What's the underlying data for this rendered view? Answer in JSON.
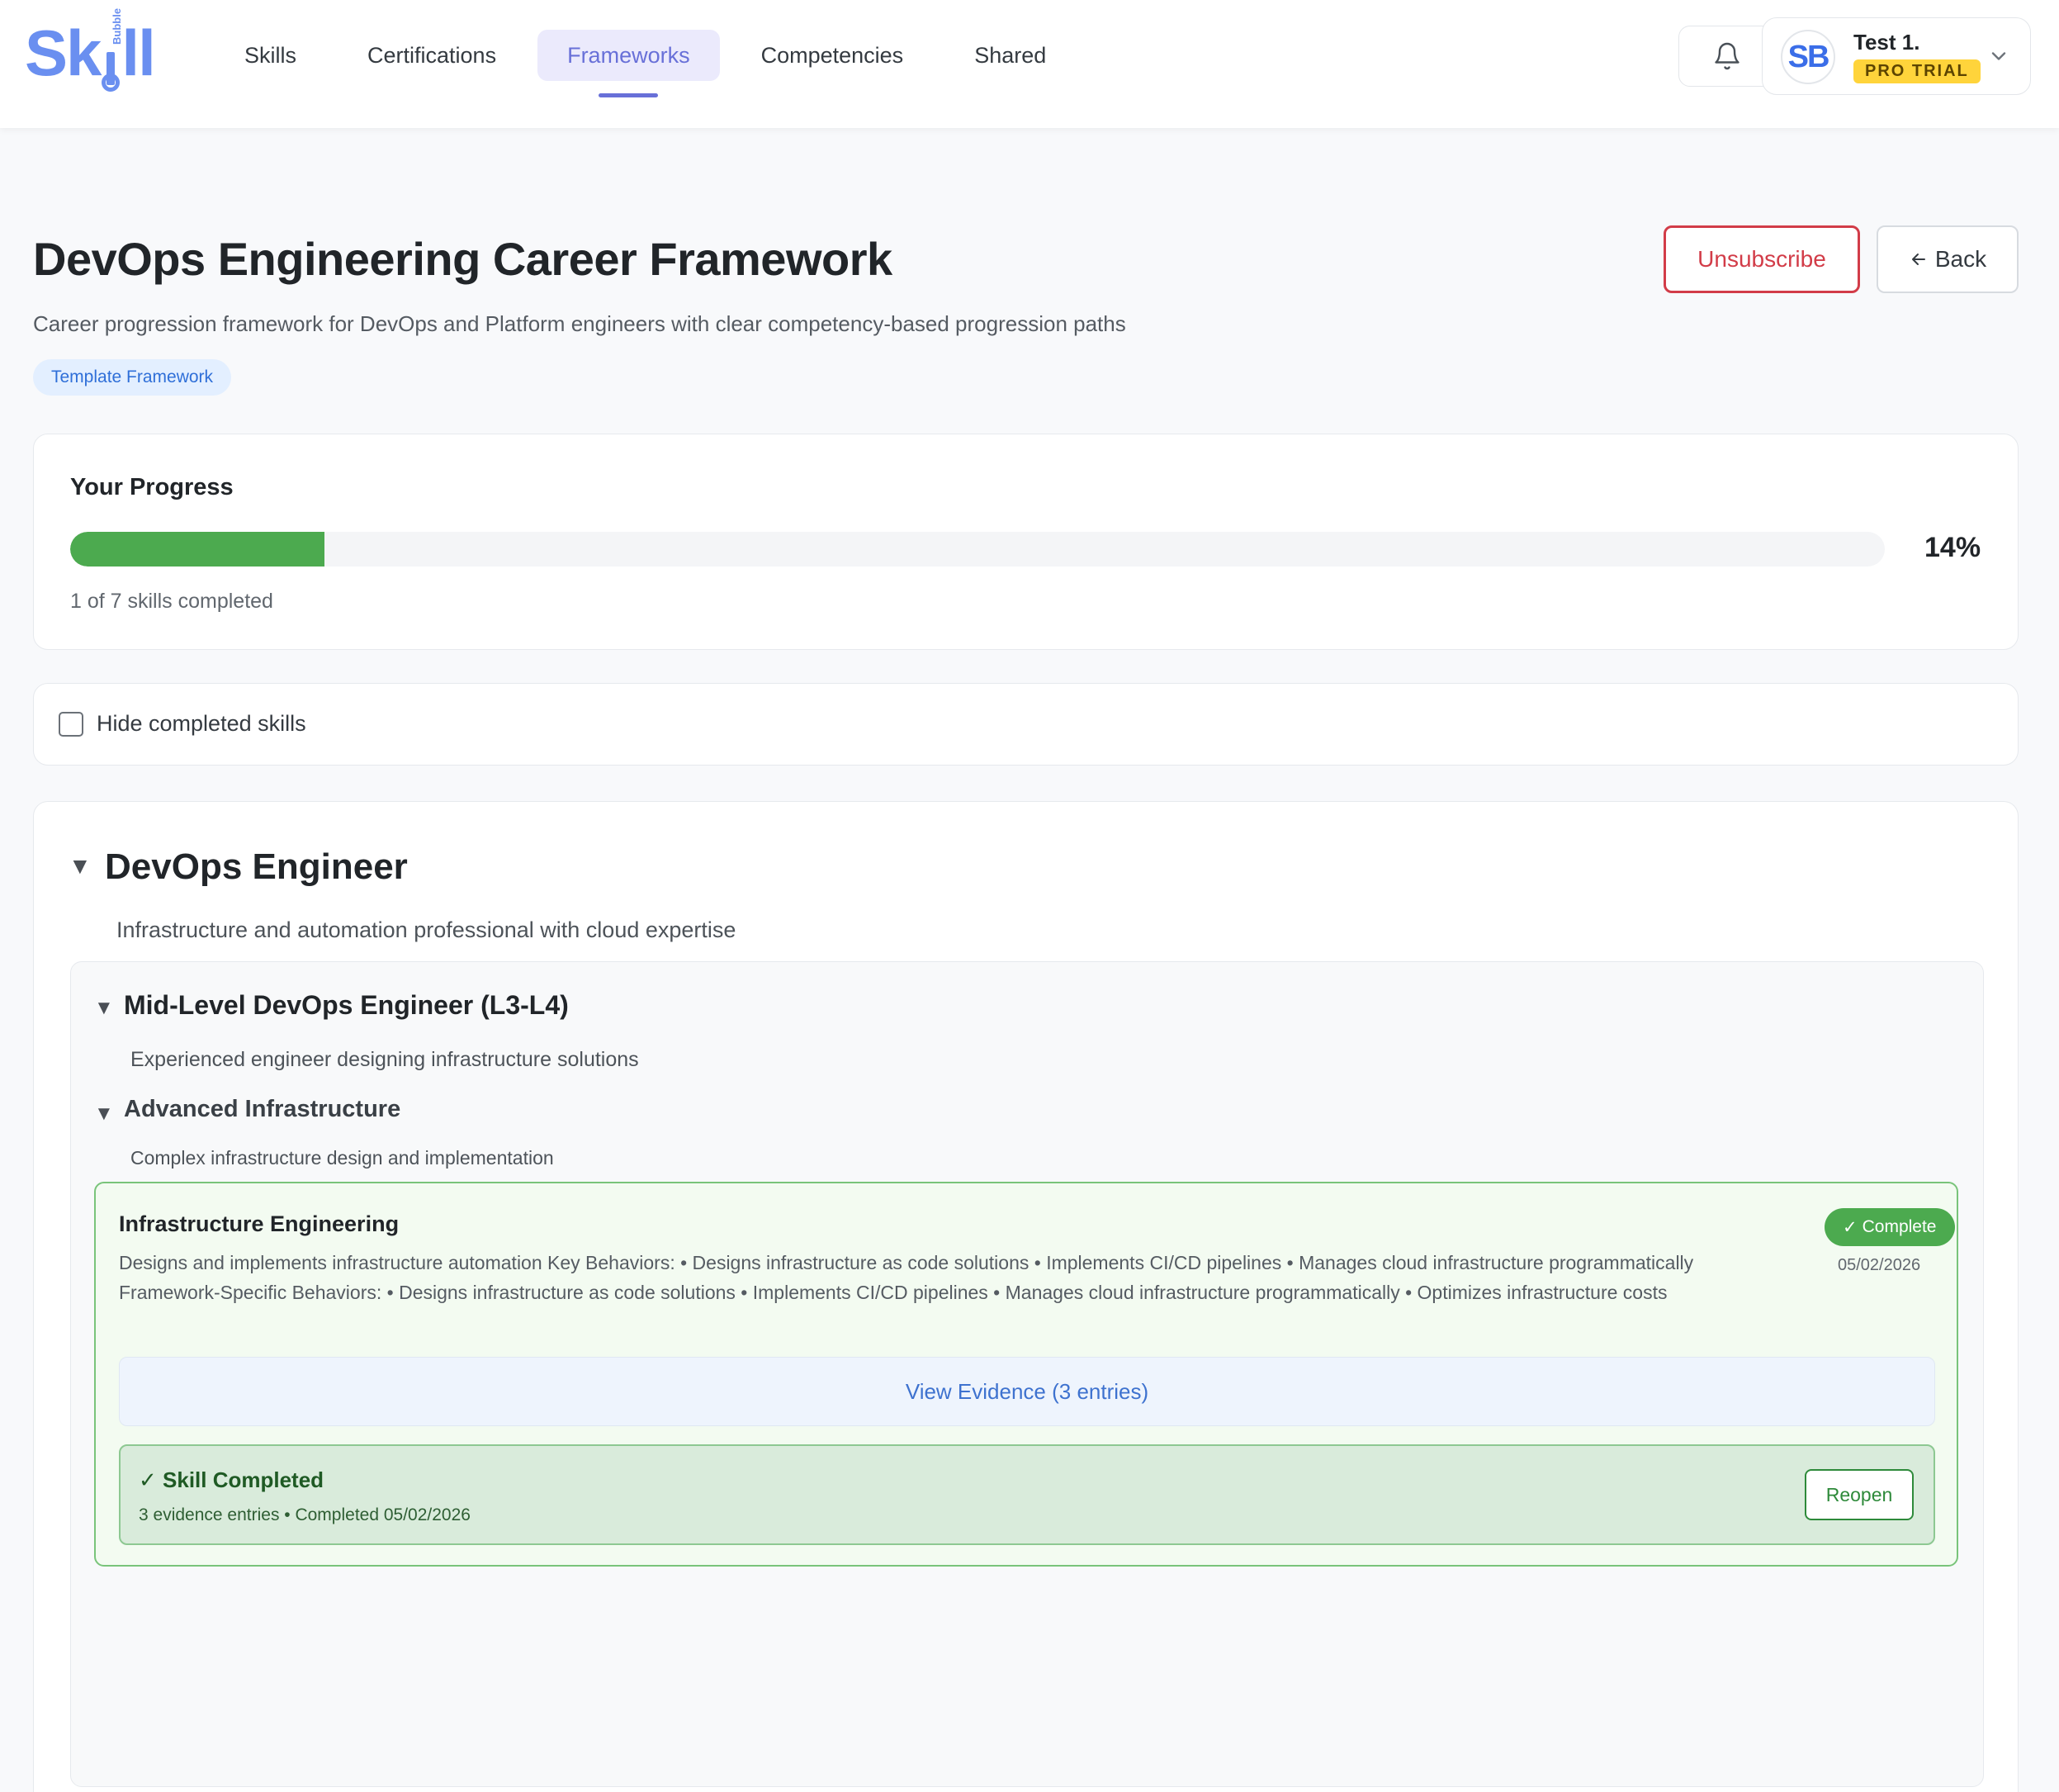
{
  "brand": {
    "name_prefix": "Sk",
    "name_suffix": "ll",
    "sub": "Bubble",
    "accent": "#6a8ff0"
  },
  "nav": {
    "items": [
      {
        "label": "Skills",
        "active": false
      },
      {
        "label": "Certifications",
        "active": false
      },
      {
        "label": "Frameworks",
        "active": true
      },
      {
        "label": "Competencies",
        "active": false
      },
      {
        "label": "Shared",
        "active": false
      }
    ]
  },
  "header": {
    "bell_icon": "bell-icon",
    "user": {
      "initials": "SB",
      "name": "Test 1.",
      "plan_badge": "PRO TRIAL"
    }
  },
  "page": {
    "title": "DevOps Engineering Career Framework",
    "description": "Career progression framework for DevOps and Platform engineers with clear competency-based progression paths",
    "badge": "Template Framework",
    "unsubscribe_label": "Unsubscribe",
    "back_label": "Back"
  },
  "progress": {
    "title": "Your Progress",
    "percent_value": 14,
    "percent_label": "14%",
    "summary": "1 of 7 skills completed",
    "fill_color": "#4caa4f"
  },
  "filter": {
    "hide_completed_label": "Hide completed skills",
    "checked": false
  },
  "framework": {
    "role": {
      "title": "DevOps Engineer",
      "description": "Infrastructure and automation professional with cloud expertise",
      "level": {
        "title": "Mid-Level DevOps Engineer (L3-L4)",
        "description": "Experienced engineer designing infrastructure solutions",
        "competency": {
          "title": "Advanced Infrastructure",
          "description": "Complex infrastructure design and implementation",
          "skill": {
            "title": "Infrastructure Engineering",
            "description": "Designs and implements infrastructure automation Key Behaviors: • Designs infrastructure as code solutions • Implements CI/CD pipelines • Manages cloud infrastructure programmatically Framework-Specific Behaviors: • Designs infrastructure as code solutions • Implements CI/CD pipelines • Manages cloud infrastructure programmatically • Optimizes infrastructure costs",
            "status_badge": "Complete",
            "date": "05/02/2026",
            "evidence_label": "View Evidence (3 entries)",
            "completed_title": "Skill Completed",
            "completed_sub": "3 evidence entries • Completed 05/02/2026",
            "reopen_label": "Reopen"
          }
        }
      }
    }
  }
}
